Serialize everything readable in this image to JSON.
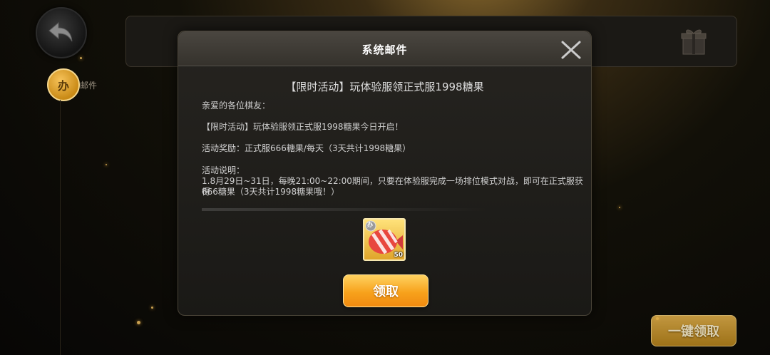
{
  "nav": {
    "back_icon": "back-arrow-icon",
    "mail_tab_label": "邮件",
    "mail_tab_icon_text": "办"
  },
  "modal": {
    "title": "系统邮件",
    "subject": "【限时活动】玩体验服领正式服1998糖果",
    "body": {
      "greeting": "亲爱的各位棋友：",
      "line1": "【限时活动】玩体验服领正式服1998糖果今日开启！",
      "line2": "活动奖励：正式服666糖果/每天（3天共计1998糖果）",
      "line3": "活动说明：",
      "line4": "1.8月29日~31日，每晚21:00~22:00期间，只要在体验服完成一场排位模式对战，即可在正式服获得",
      "line5": "666糖果（3天共计1998糖果哦！）"
    },
    "reward": {
      "icon": "candy-icon",
      "badge": "办",
      "count": "50"
    },
    "claim_label": "领取"
  },
  "footer": {
    "claim_all_label": "一键领取"
  },
  "colors": {
    "accent_orange": "#f7a21c",
    "modal_bg": "#1f1d1a",
    "header_bg": "#403c36"
  }
}
